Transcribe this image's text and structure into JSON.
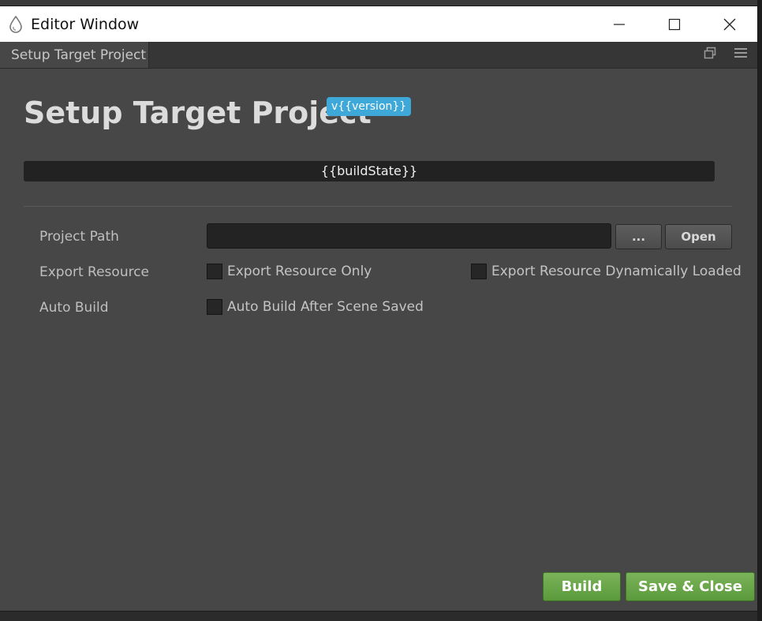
{
  "window": {
    "title": "Editor Window",
    "icon": "droplet-icon"
  },
  "tab": {
    "label": "Setup Target Project",
    "actions": [
      "restore-icon",
      "menu-icon"
    ]
  },
  "main": {
    "heading": "Setup Target Project",
    "version_badge": "v{{version}}",
    "build_state": "{{buildState}}"
  },
  "form": {
    "project_path": {
      "label": "Project Path",
      "value": "",
      "browse_label": "...",
      "open_label": "Open"
    },
    "export_resource": {
      "label": "Export Resource",
      "option_only": "Export Resource Only",
      "option_only_checked": false,
      "option_dynamic": "Export Resource Dynamically Loaded",
      "option_dynamic_checked": false
    },
    "auto_build": {
      "label": "Auto Build",
      "option": "Auto Build After Scene Saved",
      "option_checked": false
    }
  },
  "footer": {
    "build_label": "Build",
    "save_close_label": "Save & Close"
  },
  "colors": {
    "accent_badge": "#3ea9d9",
    "primary_button": "#6aa84a",
    "panel_bg": "#474747"
  }
}
